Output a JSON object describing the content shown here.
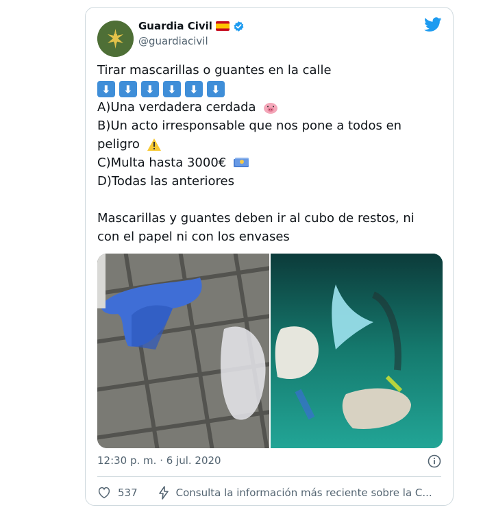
{
  "tweet": {
    "author_name": "Guardia Civil",
    "author_handle": "@guardiacivil",
    "lines": {
      "l1": "Tirar mascarillas o guantes en la calle",
      "a": "A)Una verdadera cerdada",
      "b1": "B)Un acto irresponsable que nos pone a todos en",
      "b2": "peligro",
      "c": "C)Multa hasta 3000€",
      "d": "D)Todas las anteriores",
      "p2": "Mascarillas y guantes deben ir al cubo de restos, ni con el papel ni con los envases"
    },
    "timestamp": "12:30 p. m. · 6 jul. 2020",
    "like_count": "537",
    "consult_text": "Consulta la información más reciente sobre la C..."
  },
  "icons": {
    "verified": "verified-badge-icon",
    "flag": "spain-flag-icon",
    "brand": "twitter-bird-icon",
    "info": "info-icon",
    "like": "heart-icon",
    "activity": "lightning-icon"
  },
  "colors": {
    "accent": "#1d9bf0",
    "secondary_text": "#536471",
    "emoji_arrow_bg": "#3f8ed8"
  }
}
